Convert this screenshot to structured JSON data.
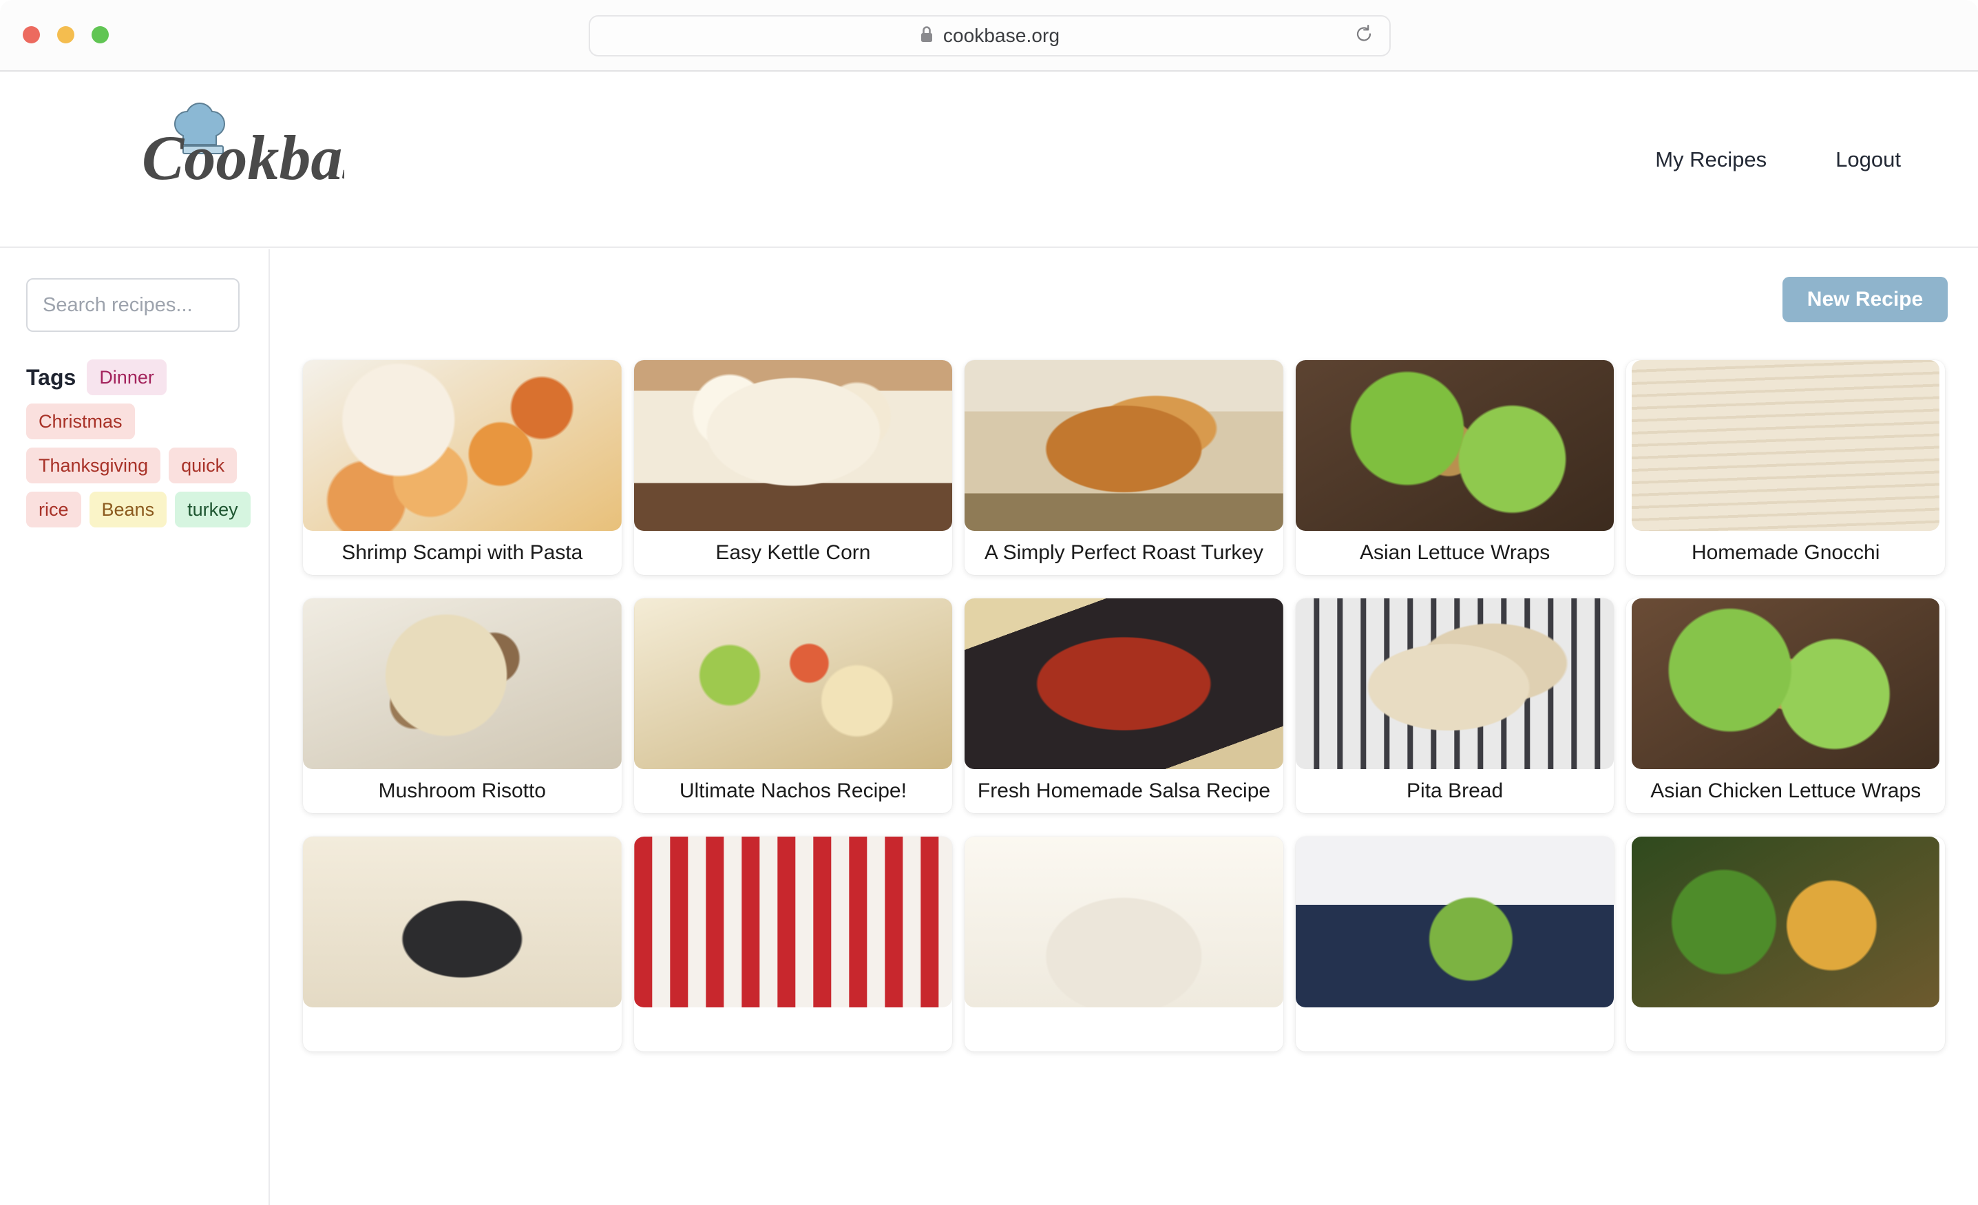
{
  "browser": {
    "url": "cookbase.org",
    "lock_icon": "lock-icon",
    "reload_icon": "reload-icon",
    "traffic_lights": [
      "close",
      "minimize",
      "maximize"
    ]
  },
  "header": {
    "brand": "Cookbase",
    "brand_icon": "chef-hat-icon",
    "nav": [
      {
        "label": "My Recipes"
      },
      {
        "label": "Logout"
      }
    ]
  },
  "sidebar": {
    "search": {
      "value": "",
      "placeholder": "Search recipes..."
    },
    "tags_label": "Tags",
    "tags": [
      {
        "label": "Dinner",
        "style": "tag-pink"
      },
      {
        "label": "Christmas",
        "style": "tag-red"
      },
      {
        "label": "Thanksgiving",
        "style": "tag-red"
      },
      {
        "label": "quick",
        "style": "tag-red"
      },
      {
        "label": "rice",
        "style": "tag-red"
      },
      {
        "label": "Beans",
        "style": "tag-yellow"
      },
      {
        "label": "turkey",
        "style": "tag-green"
      }
    ]
  },
  "toolbar": {
    "new_recipe_label": "New Recipe"
  },
  "recipes": [
    {
      "title": "Shrimp Scampi with Pasta",
      "img": "shrimp"
    },
    {
      "title": "Easy Kettle Corn",
      "img": "popcorn"
    },
    {
      "title": "A Simply Perfect Roast Turkey",
      "img": "turkey"
    },
    {
      "title": "Asian Lettuce Wraps",
      "img": "lettucewrap"
    },
    {
      "title": "Homemade Gnocchi",
      "img": "gnocchi"
    },
    {
      "title": "Mushroom Risotto",
      "img": "risotto"
    },
    {
      "title": "Ultimate Nachos Recipe!",
      "img": "nachos"
    },
    {
      "title": "Fresh Homemade Salsa Recipe",
      "img": "salsa"
    },
    {
      "title": "Pita Bread",
      "img": "pita"
    },
    {
      "title": "Asian Chicken Lettuce Wraps",
      "img": "chickenwrap"
    },
    {
      "title": "",
      "img": "bowl2"
    },
    {
      "title": "",
      "img": "checkered"
    },
    {
      "title": "",
      "img": "whitebowl"
    },
    {
      "title": "",
      "img": "greenplate"
    },
    {
      "title": "",
      "img": "saladbowl"
    }
  ],
  "colors": {
    "accent": "#8fb4cc",
    "text": "#1f2430",
    "divider": "#ebebed"
  }
}
